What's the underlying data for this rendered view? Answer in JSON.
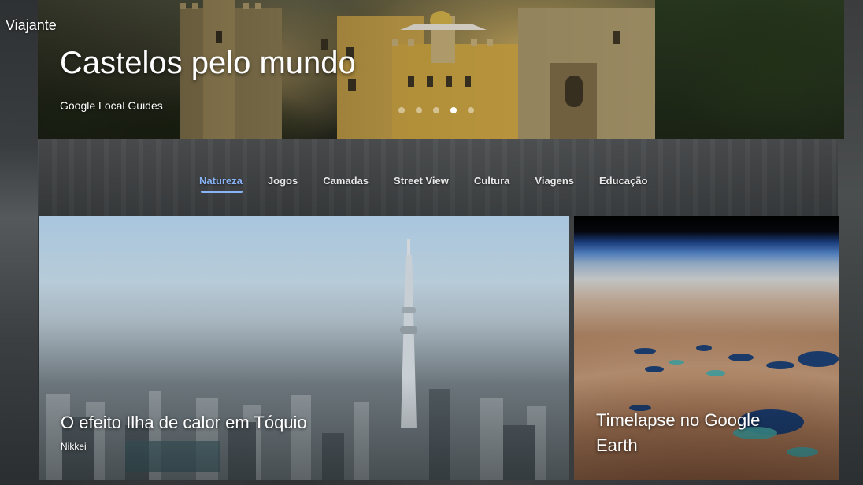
{
  "app": {
    "title": "Viajante"
  },
  "hero": {
    "title": "Castelos pelo mundo",
    "subtitle": "Google Local Guides",
    "dots_count": 5,
    "active_dot": 4
  },
  "tabs": [
    {
      "label": "Natureza",
      "active": true
    },
    {
      "label": "Jogos",
      "active": false
    },
    {
      "label": "Camadas",
      "active": false
    },
    {
      "label": "Street View",
      "active": false
    },
    {
      "label": "Cultura",
      "active": false
    },
    {
      "label": "Viagens",
      "active": false
    },
    {
      "label": "Educação",
      "active": false
    }
  ],
  "cards": [
    {
      "title": "O efeito Ilha de calor em Tóquio",
      "source": "Nikkei"
    },
    {
      "title": "Timelapse no Google Earth"
    }
  ],
  "colors": {
    "accent": "#8ab4f8",
    "text": "#ffffff"
  }
}
